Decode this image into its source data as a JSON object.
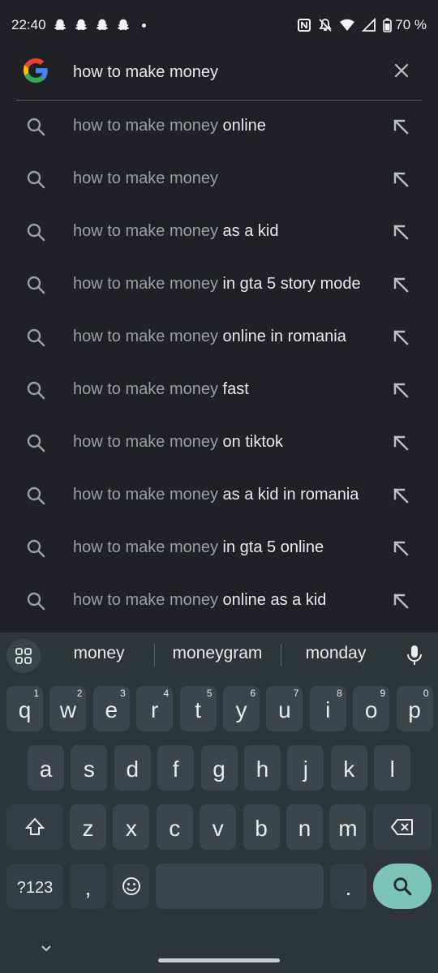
{
  "status": {
    "time": "22:40",
    "battery": "70 %"
  },
  "search": {
    "query": "how to make money",
    "placeholder": "Search"
  },
  "suggestions": [
    {
      "prefix": "how to make money",
      "suffix": " online"
    },
    {
      "prefix": "how to make money",
      "suffix": ""
    },
    {
      "prefix": "how to make money",
      "suffix": " as a kid"
    },
    {
      "prefix": "how to make money",
      "suffix": " in gta 5 story mode"
    },
    {
      "prefix": "how to make money",
      "suffix": " online in romania"
    },
    {
      "prefix": "how to make money",
      "suffix": " fast"
    },
    {
      "prefix": "how to make money",
      "suffix": " on tiktok"
    },
    {
      "prefix": "how to make money",
      "suffix": " as a kid in romania"
    },
    {
      "prefix": "how to make money",
      "suffix": " in gta 5 online"
    },
    {
      "prefix": "how to make money",
      "suffix": " online as a kid"
    }
  ],
  "keyboard": {
    "suggestions": [
      "money",
      "moneygram",
      "monday"
    ],
    "row1": [
      {
        "k": "q",
        "h": "1"
      },
      {
        "k": "w",
        "h": "2"
      },
      {
        "k": "e",
        "h": "3"
      },
      {
        "k": "r",
        "h": "4"
      },
      {
        "k": "t",
        "h": "5"
      },
      {
        "k": "y",
        "h": "6"
      },
      {
        "k": "u",
        "h": "7"
      },
      {
        "k": "i",
        "h": "8"
      },
      {
        "k": "o",
        "h": "9"
      },
      {
        "k": "p",
        "h": "0"
      }
    ],
    "row2": [
      "a",
      "s",
      "d",
      "f",
      "g",
      "h",
      "j",
      "k",
      "l"
    ],
    "row3": [
      "z",
      "x",
      "c",
      "v",
      "b",
      "n",
      "m"
    ],
    "symbols_label": "?123",
    "comma": ",",
    "period": "."
  },
  "colors": {
    "background": "#202124",
    "keyboard": "#2d3539",
    "key": "#3c4549",
    "accent": "#7cc4b5"
  }
}
